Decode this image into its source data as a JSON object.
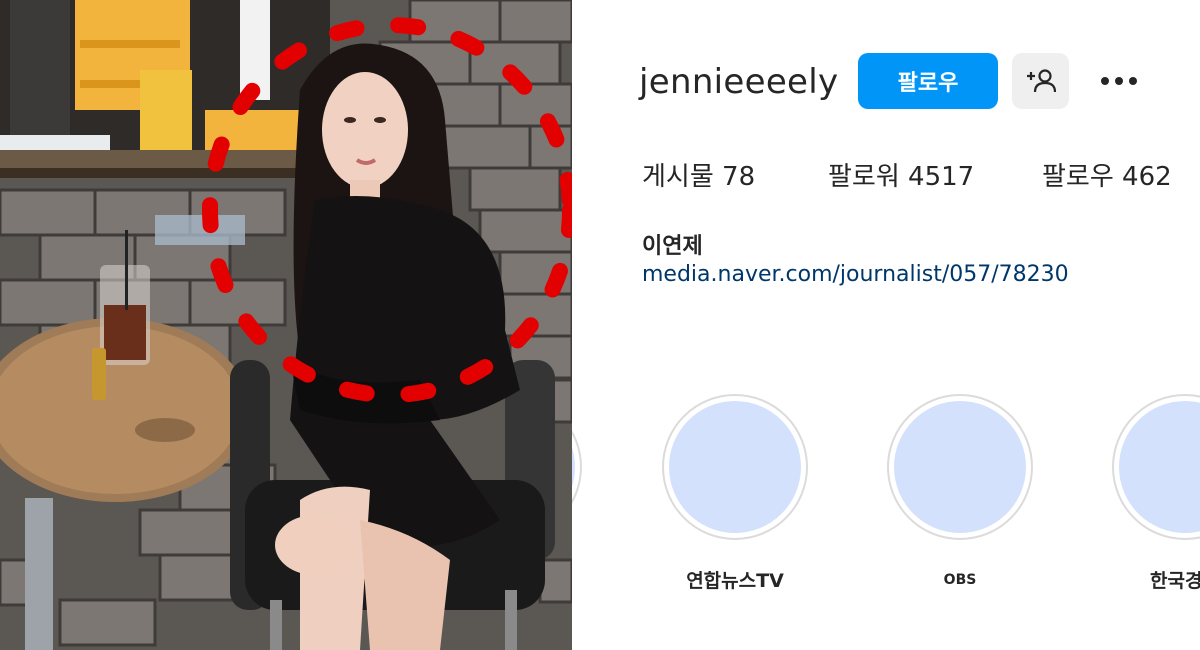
{
  "profile": {
    "username": "jennieeeely",
    "follow_label": "팔로우",
    "add_icon": "add-person-icon",
    "more_icon": "more-horizontal-icon",
    "stats": {
      "posts_label": "게시물",
      "posts_count": "78",
      "followers_label": "팔로워",
      "followers_count": "4517",
      "following_label": "팔로우",
      "following_count": "462"
    },
    "full_name": "이연제",
    "website": "media.naver.com/journalist/057/78230"
  },
  "highlights": [
    {
      "label": "연합뉴스TV"
    },
    {
      "label": "OBS"
    },
    {
      "label": "한국경제"
    }
  ],
  "colors": {
    "follow_button": "#0095f6",
    "link": "#00376b",
    "highlight_fill": "#d4e1fd",
    "annotation_dots": "#e30000"
  }
}
